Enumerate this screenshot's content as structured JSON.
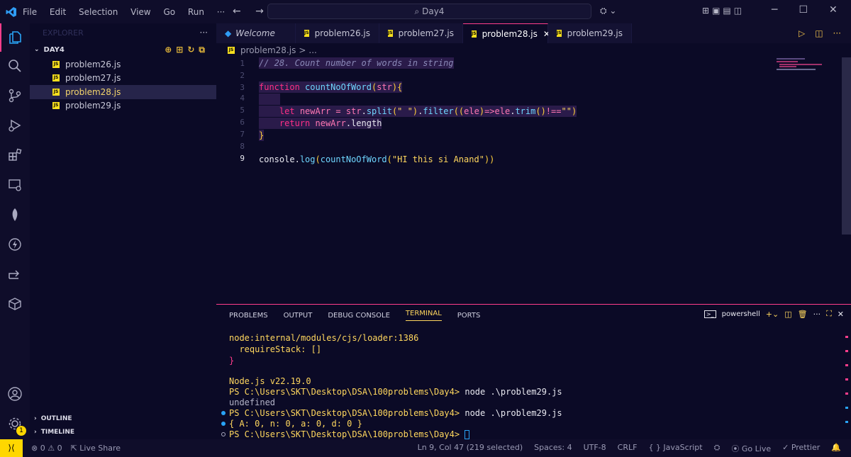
{
  "titlebar": {
    "menu": [
      "File",
      "Edit",
      "Selection",
      "View",
      "Go",
      "Run",
      "···"
    ],
    "search": "Day4",
    "nav": "← →",
    "window_controls": [
      "─",
      "☐",
      "✕"
    ],
    "accent": "#ff3d8b"
  },
  "activitybar": {
    "icons": [
      "explorer-icon",
      "search-icon",
      "source-control-icon",
      "run-debug-icon",
      "extensions-icon",
      "remote-explorer-icon",
      "mongodb-icon",
      "thunder-client-icon",
      "live-share-icon",
      "database-icon",
      "account-icon",
      "settings-icon"
    ],
    "settings_badge": "1"
  },
  "sidebar": {
    "header": "EXPLORER",
    "header_more": "···",
    "folder": "DAY4",
    "files": [
      "problem26.js",
      "problem27.js",
      "problem28.js",
      "problem29.js"
    ],
    "selected": "problem28.js",
    "outline": "OUTLINE",
    "timeline": "TIMELINE"
  },
  "tabs": [
    {
      "label": "Welcome",
      "icon": "vscode-icon"
    },
    {
      "label": "problem26.js",
      "icon": "js-icon"
    },
    {
      "label": "problem27.js",
      "icon": "js-icon"
    },
    {
      "label": "problem28.js",
      "icon": "js-icon",
      "active": true
    },
    {
      "label": "problem29.js",
      "icon": "js-icon"
    }
  ],
  "breadcrumb": {
    "file": "problem28.js",
    "sep": ">",
    "rest": "..."
  },
  "editor": {
    "line_numbers": [
      "1",
      "2",
      "3",
      "4",
      "5",
      "6",
      "7",
      "8",
      "9"
    ],
    "current_line": "9"
  },
  "panel": {
    "tabs": [
      "PROBLEMS",
      "OUTPUT",
      "DEBUG CONSOLE",
      "TERMINAL",
      "PORTS"
    ],
    "active_tab": "TERMINAL",
    "shell": "powershell",
    "terminal": {
      "l1": "node:internal/modules/cjs/loader:1386",
      "l2": "  requireStack: []",
      "l3": "}",
      "l4": "Node.js v22.19.0",
      "l5_prompt": "PS C:\\Users\\SKT\\Desktop\\DSA\\100problems\\Day4>",
      "l5_cmd": "node",
      "l5_arg": ".\\problem29.js",
      "l6": "undefined",
      "l7_prompt": "PS C:\\Users\\SKT\\Desktop\\DSA\\100problems\\Day4>",
      "l7_cmd": "node",
      "l7_arg": ".\\problem29.js",
      "l8": "{ A: 0, n: 0, a: 0, d: 0 }",
      "l9_prompt": "PS C:\\Users\\SKT\\Desktop\\DSA\\100problems\\Day4>"
    }
  },
  "statusbar": {
    "problems": "⊗ 0 ⚠ 0",
    "live_share": "Live Share",
    "position": "Ln 9, Col 47 (219 selected)",
    "spaces": "Spaces: 4",
    "encoding": "UTF-8",
    "eol": "CRLF",
    "language": "{ } JavaScript",
    "go_live": "Go Live",
    "prettier": "✓ Prettier"
  }
}
